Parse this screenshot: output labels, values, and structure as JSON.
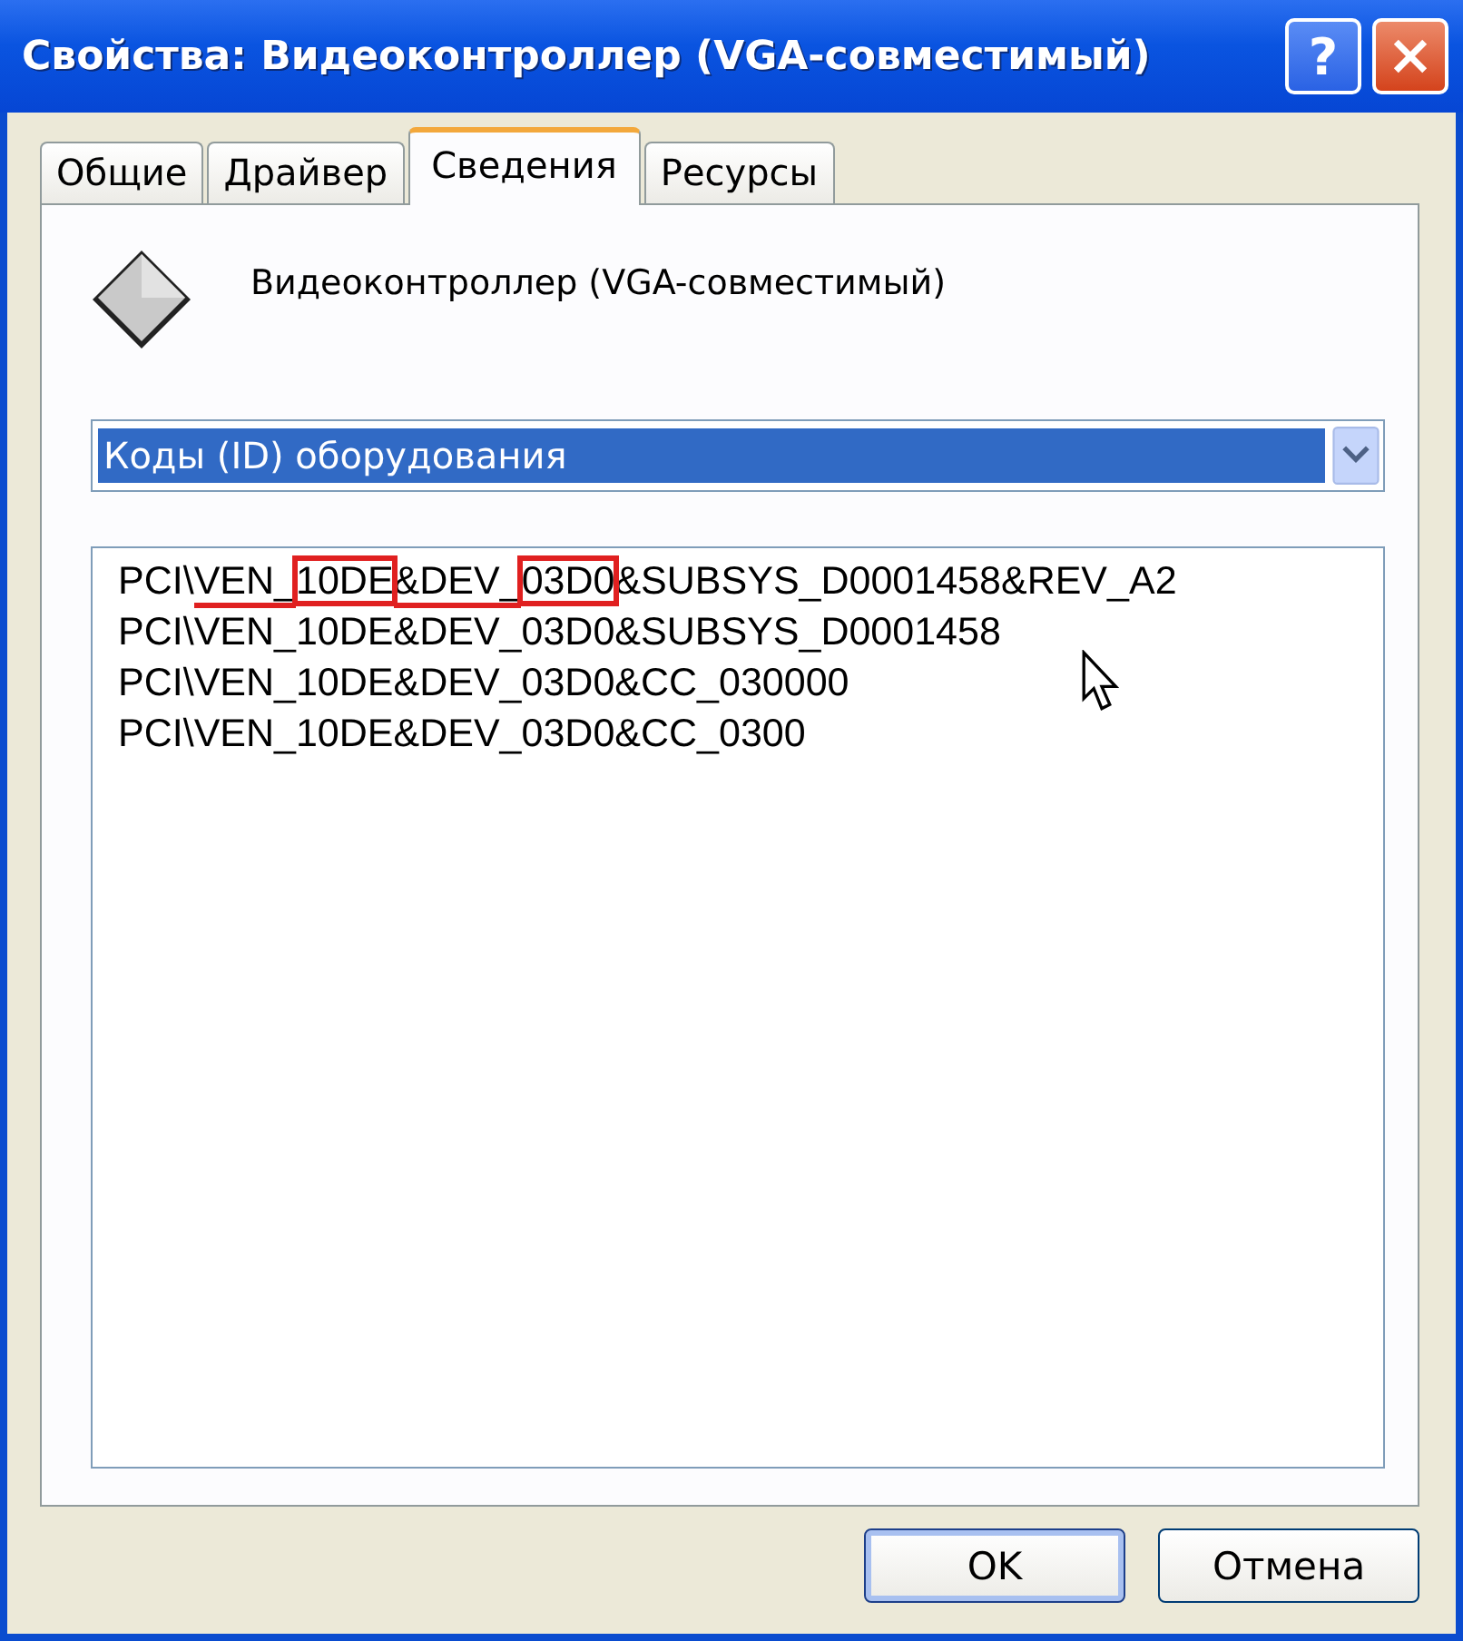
{
  "window": {
    "title": "Свойства: Видеоконтроллер (VGA-совместимый)",
    "buttons": [
      {
        "kind": "help",
        "label": "?"
      },
      {
        "kind": "close"
      }
    ]
  },
  "tabs": [
    {
      "label": "Общие",
      "selected": false
    },
    {
      "label": "Драйвер",
      "selected": false
    },
    {
      "label": "Сведения",
      "selected": true
    },
    {
      "label": "Ресурсы",
      "selected": false
    }
  ],
  "device": {
    "name": "Видеоконтроллер (VGA-совместимый)"
  },
  "property_dropdown": {
    "value": "Коды (ID) оборудования"
  },
  "values": [
    {
      "parts": [
        {
          "text": "PCI\\"
        },
        {
          "text": "VEN_",
          "underlined": true
        },
        {
          "text": "10DE",
          "boxed": true
        },
        {
          "text": "&DEV_",
          "underlined": true
        },
        {
          "text": "03D0",
          "boxed": true
        },
        {
          "text": "&SUBSYS_D0001458&REV_A2"
        }
      ]
    },
    {
      "parts": [
        {
          "text": "PCI\\VEN_10DE&DEV_03D0&SUBSYS_D0001458"
        }
      ]
    },
    {
      "parts": [
        {
          "text": "PCI\\VEN_10DE&DEV_03D0&CC_030000"
        }
      ]
    },
    {
      "parts": [
        {
          "text": "PCI\\VEN_10DE&DEV_03D0&CC_0300"
        }
      ]
    }
  ],
  "buttons": [
    {
      "label": "OK",
      "default": true
    },
    {
      "label": "Отмена",
      "default": false
    }
  ]
}
